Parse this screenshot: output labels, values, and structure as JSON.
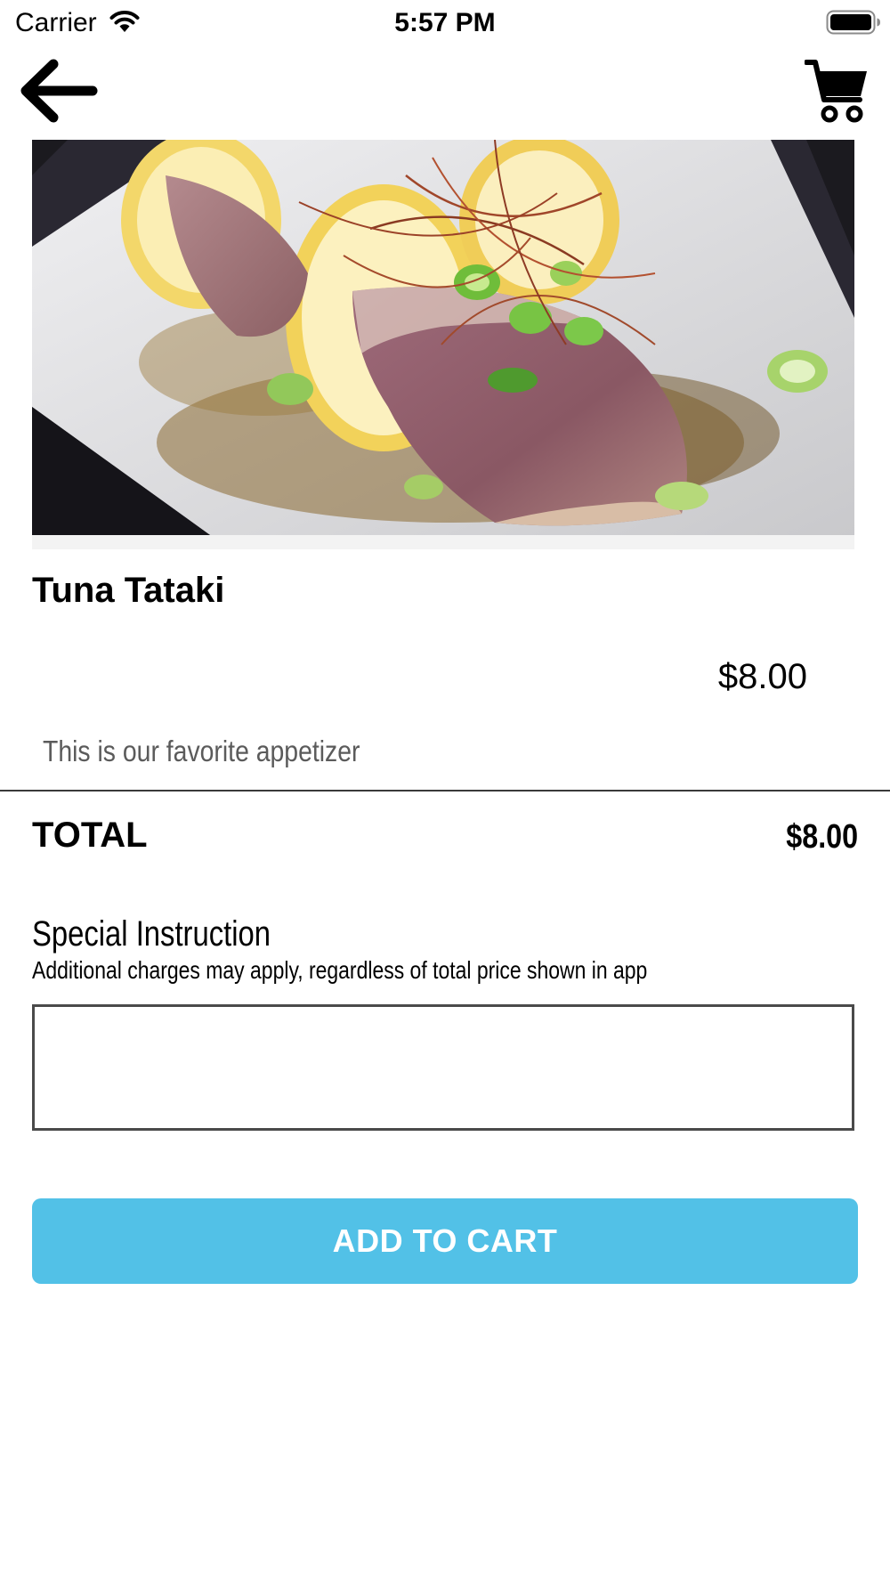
{
  "status_bar": {
    "carrier": "Carrier",
    "time": "5:57 PM",
    "wifi_icon": "wifi-icon",
    "battery_icon": "battery-icon"
  },
  "nav": {
    "back_icon": "arrow-left-icon",
    "cart_icon": "shopping-cart-icon"
  },
  "item": {
    "image_description_icon": "food-photo",
    "name": "Tuna Tataki",
    "price": "$8.00",
    "description": "This is our favorite appetizer"
  },
  "total": {
    "label": "TOTAL",
    "value": "$8.00"
  },
  "special_instruction": {
    "title": "Special Instruction",
    "note": "Additional charges may apply, regardless of total price shown in app",
    "value": "",
    "placeholder": ""
  },
  "actions": {
    "add_to_cart": "ADD TO CART"
  },
  "colors": {
    "accent": "#52c1e7",
    "text": "#000000",
    "muted_text": "#5b5b5b",
    "divider": "#3a3a3a"
  }
}
